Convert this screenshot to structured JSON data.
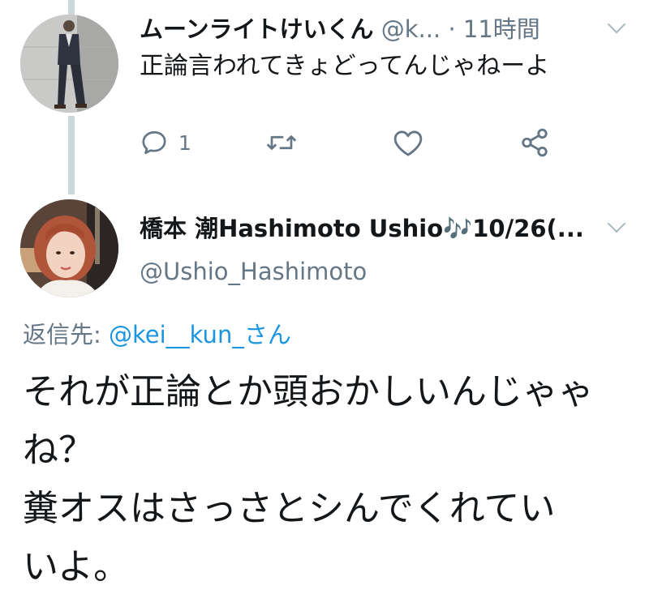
{
  "tweet1": {
    "display_name": "ムーンライトけいくん",
    "handle": "@k...",
    "separator": "·",
    "time": "11時間",
    "text": "正論言われてきょどってんじゃねーよ",
    "actions": {
      "reply_count": "1"
    }
  },
  "tweet2": {
    "display_name": "橋本 潮Hashimoto Ushio",
    "music_icon": "🎶",
    "date": "10/26(...",
    "handle": "@Ushio_Hashimoto",
    "reply_label": "返信先:",
    "reply_mention": "@kei__kun_さん",
    "text_lines": [
      "それが正論とか頭おかしいんじゃゃ",
      "ね？",
      "糞オスはさっさとシんでくれてい",
      "いよ。"
    ]
  },
  "colors": {
    "link": "#1b95e0",
    "secondary_text": "#657786",
    "thread_line": "#ccd6dd",
    "icon": "#657786"
  }
}
